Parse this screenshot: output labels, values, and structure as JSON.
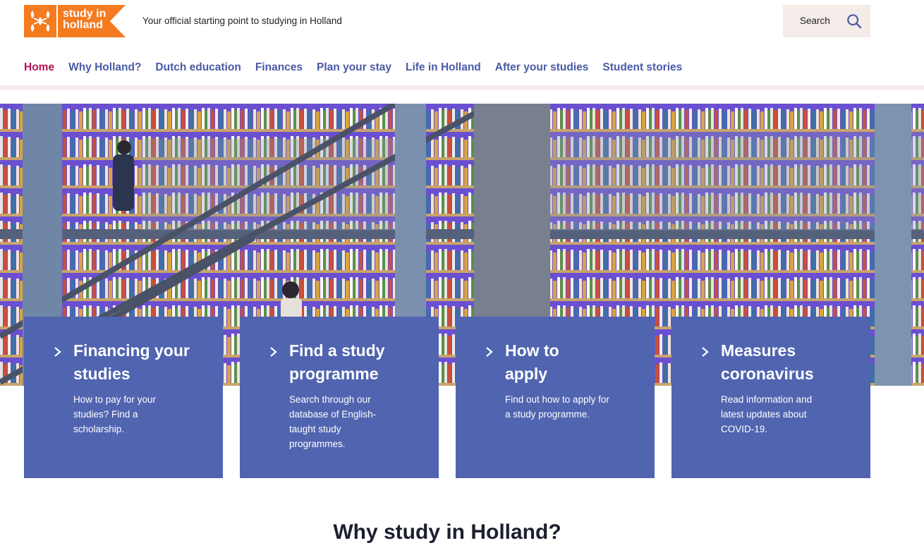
{
  "header": {
    "logo_text_line1": "study in",
    "logo_text_line2": "holland",
    "tagline": "Your official starting point to studying in Holland",
    "search_label": "Search"
  },
  "nav": {
    "items": [
      {
        "label": "Home",
        "active": true
      },
      {
        "label": "Why Holland?",
        "active": false
      },
      {
        "label": "Dutch education",
        "active": false
      },
      {
        "label": "Finances",
        "active": false
      },
      {
        "label": "Plan your stay",
        "active": false
      },
      {
        "label": "Life in Holland",
        "active": false
      },
      {
        "label": "After your studies",
        "active": false
      },
      {
        "label": "Student stories",
        "active": false
      }
    ]
  },
  "cards": [
    {
      "title": "Financing your studies",
      "description": "How to pay for your studies? Find a scholarship."
    },
    {
      "title": "Find a study programme",
      "description": "Search through our database of English-taught study programmes."
    },
    {
      "title": "How to apply",
      "description": "Find out how to apply for a study programme."
    },
    {
      "title": "Measures coronavirus",
      "description": "Read information and latest updates about COVID-19."
    }
  ],
  "section": {
    "title": "Why study in Holland?"
  },
  "colors": {
    "brand_orange": "#f47b20",
    "nav_blue": "#4a5aa6",
    "nav_active": "#b01454",
    "card_blue": "#5064b0",
    "search_bg": "#f4ece9"
  },
  "icons": {
    "logo": "tulip-logo-icon",
    "search": "search-icon",
    "card_arrow": "chevron-right-icon"
  }
}
